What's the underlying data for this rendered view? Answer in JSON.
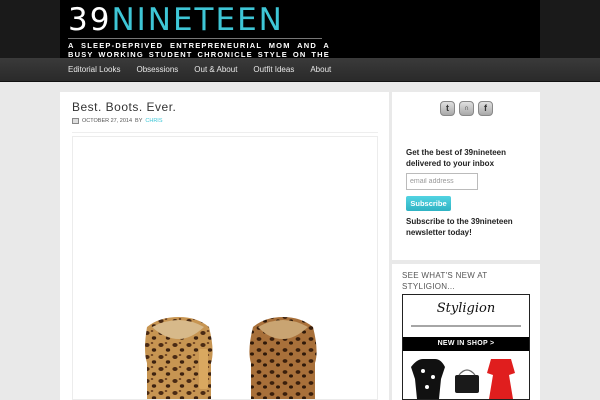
{
  "header": {
    "logo_prefix": "39",
    "logo_accent": "NINETEEN",
    "tagline": "A SLEEP-DEPRIVED ENTREPRENEURIAL MOM AND A BUSY WORKING STUDENT CHRONICLE STYLE ON THE GO"
  },
  "nav": {
    "items": [
      {
        "label": "Editorial Looks"
      },
      {
        "label": "Obsessions"
      },
      {
        "label": "Out & About"
      },
      {
        "label": "Outfit Ideas"
      },
      {
        "label": "About"
      }
    ]
  },
  "post": {
    "title": "Best. Boots. Ever.",
    "date": "OCTOBER 27, 2014",
    "by": "BY",
    "author": "CHRIS"
  },
  "sidebar": {
    "social": {
      "twitter": "t",
      "facebook": "f"
    },
    "newsletter": {
      "heading": "Get the best of 39nineteen delivered to your inbox",
      "placeholder": "email address",
      "button": "Subscribe",
      "footer": "Subscribe to the 39nineteen newsletter today!"
    },
    "styligion": {
      "heading": "SEE WHAT'S NEW AT STYLIGION...",
      "logo": "Styligion",
      "banner": "NEW IN SHOP >"
    }
  },
  "colors": {
    "accent": "#3ec6d6",
    "background": "#e9e9e9",
    "header_bg": "#000000",
    "nav_bg": "#2f2f2f"
  },
  "icons": [
    "calendar-icon",
    "twitter-icon",
    "stumbleupon-icon",
    "facebook-icon"
  ]
}
